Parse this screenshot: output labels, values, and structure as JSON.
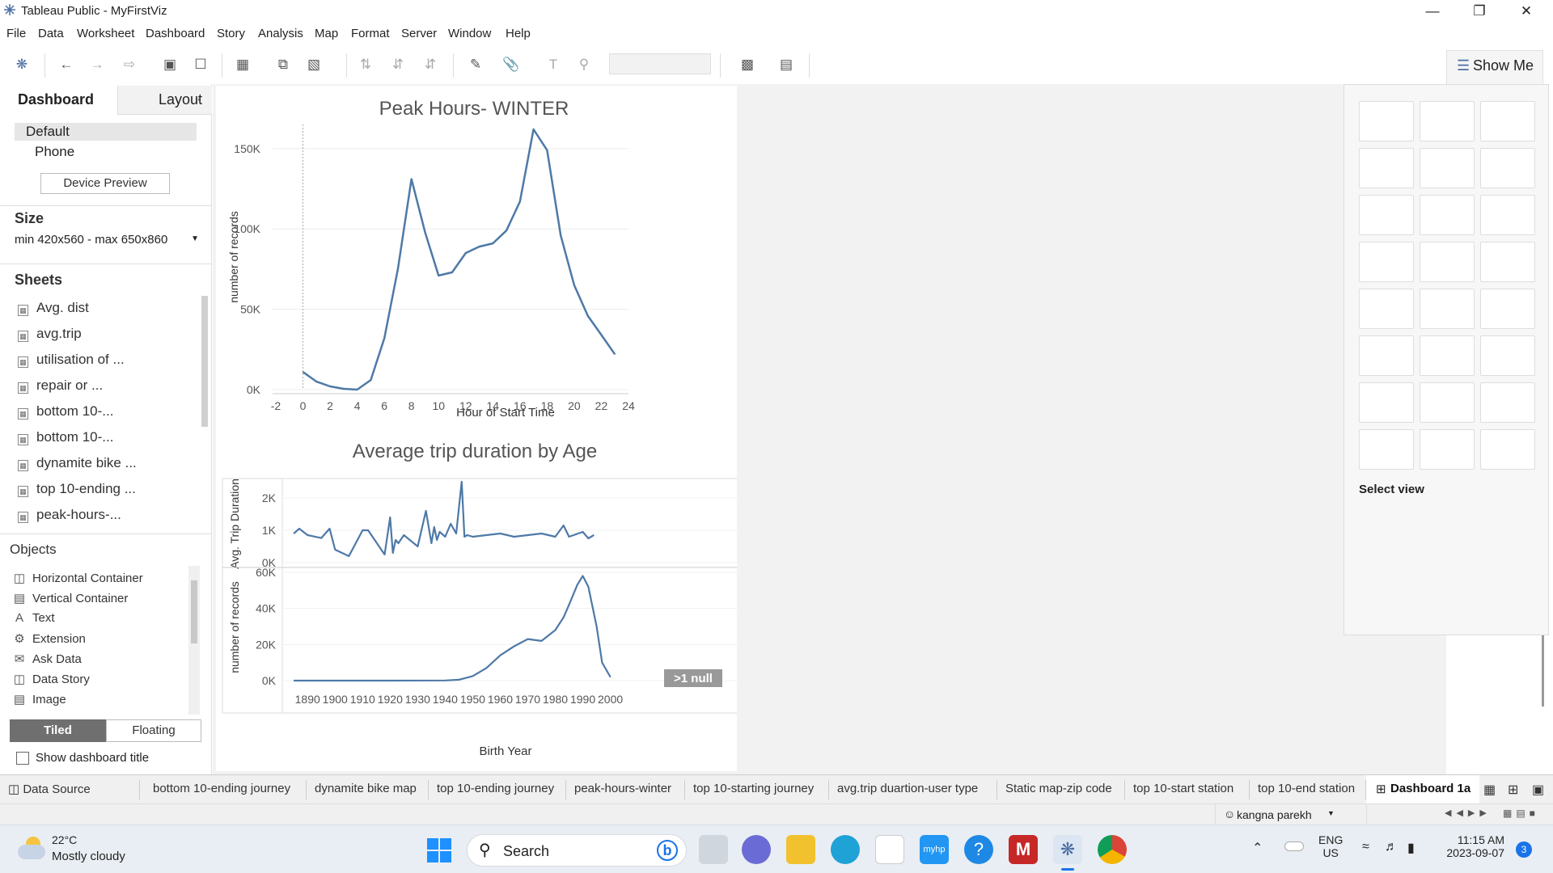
{
  "window": {
    "title": "Tableau Public - MyFirstViz"
  },
  "menu": [
    "File",
    "Data",
    "Worksheet",
    "Dashboard",
    "Story",
    "Analysis",
    "Map",
    "Format",
    "Server",
    "Window",
    "Help"
  ],
  "show_me": {
    "tab_label": "Show Me",
    "select_view": "Select view"
  },
  "left_pane": {
    "tabs": {
      "dashboard": "Dashboard",
      "layout": "Layout"
    },
    "devices": {
      "default": "Default",
      "phone": "Phone",
      "preview_button": "Device Preview"
    },
    "size": {
      "title": "Size",
      "value": "min 420x560 - max 650x860"
    },
    "sheets_title": "Sheets",
    "sheets": [
      "Avg. dist",
      "avg.trip",
      "utilisation of ...",
      "repair or ...",
      "bottom 10-...",
      "bottom 10-...",
      "dynamite bike ...",
      "top 10-ending ...",
      "peak-hours-..."
    ],
    "objects_title": "Objects",
    "objects": [
      "Horizontal Container",
      "Vertical Container",
      "Text",
      "Extension",
      "Ask Data",
      "Data Story",
      "Image"
    ],
    "layout_mode": {
      "tiled": "Tiled",
      "floating": "Floating"
    },
    "show_title": "Show dashboard title"
  },
  "charts": {
    "peak": {
      "title": "Peak Hours- WINTER",
      "ylabel": "number of records",
      "xlabel": "Hour of Start Time",
      "xticks": [
        "-2",
        "0",
        "2",
        "4",
        "6",
        "8",
        "10",
        "12",
        "14",
        "16",
        "18",
        "20",
        "22",
        "24"
      ],
      "yticks": [
        "150K",
        "100K",
        "50K",
        "0K"
      ]
    },
    "age": {
      "title": "Average trip duration by Age",
      "ylabel_top": "Avg. Trip Duration",
      "ylabel_bottom": "number of records",
      "xlabel": "Birth Year",
      "yticks_top": [
        "2K",
        "1K",
        "0K"
      ],
      "yticks_bottom": [
        "60K",
        "40K",
        "20K",
        "0K"
      ],
      "xticks": [
        "1890",
        "1900",
        "1910",
        "1920",
        "1930",
        "1940",
        "1950",
        "1960",
        "1970",
        "1980",
        "1990",
        "2000"
      ],
      "null_badge": ">1 null"
    }
  },
  "chart_data": [
    {
      "type": "line",
      "title": "Peak Hours- WINTER",
      "xlabel": "Hour of Start Time",
      "ylabel": "number of records",
      "xlim": [
        -2,
        24
      ],
      "ylim": [
        0,
        165000
      ],
      "x": [
        0,
        1,
        2,
        3,
        4,
        5,
        6,
        7,
        8,
        9,
        10,
        11,
        12,
        13,
        14,
        15,
        16,
        17,
        18,
        19,
        20,
        21,
        22,
        23
      ],
      "values": [
        11000,
        5000,
        2000,
        500,
        0,
        6000,
        32000,
        75000,
        131000,
        98000,
        71000,
        73000,
        85000,
        89000,
        91000,
        99000,
        117000,
        162000,
        149000,
        96000,
        65000,
        46000,
        34000,
        22000
      ]
    },
    {
      "type": "line",
      "title": "Average trip duration by Age",
      "xlabel": "Birth Year",
      "ylabel": "Avg. Trip Duration",
      "ylim": [
        0,
        2500
      ],
      "x": [
        1885,
        1887,
        1890,
        1895,
        1898,
        1900,
        1905,
        1910,
        1912,
        1918,
        1920,
        1921,
        1922,
        1923,
        1925,
        1930,
        1933,
        1935,
        1936,
        1937,
        1938,
        1940,
        1942,
        1944,
        1946,
        1947,
        1948,
        1950,
        1955,
        1960,
        1965,
        1970,
        1975,
        1980,
        1983,
        1985,
        1990,
        1992,
        1994
      ],
      "values": [
        900,
        1050,
        850,
        760,
        1050,
        400,
        200,
        1000,
        1000,
        250,
        1400,
        300,
        700,
        600,
        850,
        500,
        1600,
        600,
        1100,
        700,
        950,
        800,
        1200,
        900,
        2500,
        800,
        850,
        800,
        850,
        900,
        800,
        850,
        900,
        800,
        1150,
        800,
        950,
        750,
        850
      ]
    },
    {
      "type": "area",
      "title": "Average trip duration by Age",
      "xlabel": "Birth Year",
      "ylabel": "number of records",
      "ylim": [
        0,
        60000
      ],
      "x": [
        1885,
        1900,
        1920,
        1940,
        1945,
        1950,
        1955,
        1960,
        1965,
        1970,
        1975,
        1980,
        1983,
        1985,
        1988,
        1990,
        1992,
        1995,
        1997,
        2000
      ],
      "values": [
        0,
        0,
        0,
        100,
        500,
        2500,
        7000,
        14000,
        19000,
        23000,
        22000,
        28000,
        35000,
        42000,
        53000,
        58000,
        52000,
        30000,
        10000,
        2000
      ]
    }
  ],
  "bottom_tabs": [
    "Data Source",
    "bottom 10-ending journey",
    "dynamite bike map",
    "top 10-ending journey",
    "peak-hours-winter",
    "top 10-starting journey",
    "avg.trip duartion-user type",
    "Static map-zip code",
    "top 10-start station",
    "top 10-end station",
    "Dashboard 1a"
  ],
  "status": {
    "user": "kangna parekh"
  },
  "taskbar": {
    "weather_temp": "22°C",
    "weather_desc": "Mostly cloudy",
    "search": "Search",
    "lang": "ENG",
    "region": "US",
    "time": "11:15 AM",
    "date": "2023-09-07",
    "notif_count": "3"
  }
}
